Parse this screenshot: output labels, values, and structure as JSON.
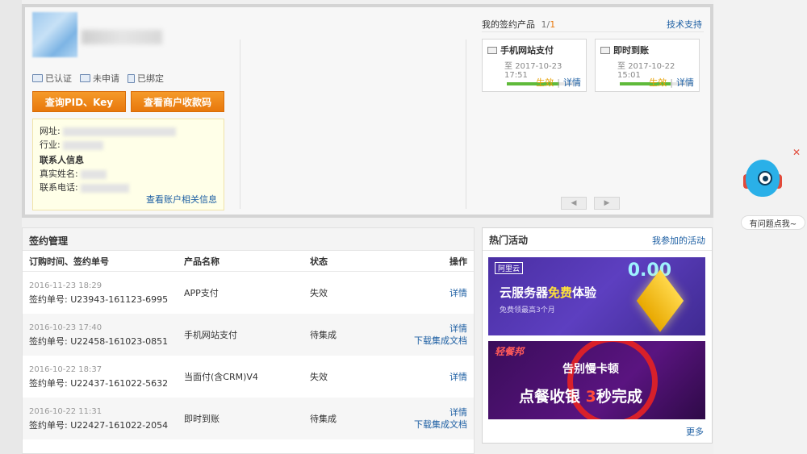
{
  "account": {
    "statuses": [
      {
        "icon": "id-card-icon",
        "label": "已认证"
      },
      {
        "icon": "form-icon",
        "label": "未申请"
      },
      {
        "icon": "lock-icon",
        "label": "已绑定"
      }
    ],
    "buttons": {
      "query_pid": "查询PID、Key",
      "view_qrcode": "查看商户收款码"
    },
    "info": {
      "website_label": "网址:",
      "industry_label": "行业:",
      "contact_title": "联系人信息",
      "name_label": "真实姓名:",
      "phone_label": "联系电话:",
      "more_link": "查看账户相关信息"
    }
  },
  "products": {
    "title": "我的签约产品",
    "count_current": "1",
    "count_sep": "/",
    "count_total": "1",
    "tech_support": "技术支持",
    "cards": [
      {
        "name": "手机网站支付",
        "prefix": "至",
        "date": "2017-10-23 17:51",
        "progress": 0.72,
        "status": "生效",
        "detail": "详情"
      },
      {
        "name": "即时到账",
        "prefix": "至",
        "date": "2017-10-22 15:01",
        "progress": 0.7,
        "status": "生效",
        "detail": "详情"
      }
    ]
  },
  "contracts": {
    "title": "签约管理",
    "headers": {
      "time": "订购时间、签约单号",
      "product": "产品名称",
      "status": "状态",
      "action": "操作"
    },
    "rows": [
      {
        "time": "2016-11-23 18:29",
        "order": "签约单号: U23943-161123-6995",
        "product": "APP支付",
        "status": "失效",
        "actions": [
          "详情"
        ]
      },
      {
        "time": "2016-10-23 17:40",
        "order": "签约单号: U22458-161023-0851",
        "product": "手机网站支付",
        "status": "待集成",
        "actions": [
          "详情",
          "下载集成文档"
        ]
      },
      {
        "time": "2016-10-22 18:37",
        "order": "签约单号: U22437-161022-5632",
        "product": "当面付(含CRM)V4",
        "status": "失效",
        "actions": [
          "详情"
        ]
      },
      {
        "time": "2016-10-22 11:31",
        "order": "签约单号: U22427-161022-2054",
        "product": "即时到账",
        "status": "待集成",
        "actions": [
          "详情",
          "下载集成文档"
        ]
      }
    ]
  },
  "activities": {
    "title": "热门活动",
    "joined_link": "我参加的活动",
    "banner1": {
      "logo": "阿里云",
      "main_a": "云服务器",
      "main_b": "免费",
      "main_c": "体验",
      "sub": "免费领最高3个月",
      "num": "0.00"
    },
    "banner2": {
      "brand": "轻餐邦",
      "line1": "告别慢卡顿",
      "line2_a": "点餐收银 ",
      "line2_b": "3",
      "line2_c": "秒完成"
    },
    "more": "更多"
  },
  "helper": {
    "bubble": "有问题点我~",
    "close": "✕"
  },
  "colors": {
    "accent": "#e8780c",
    "link": "#1d5fa3",
    "progress": "#5fba3a"
  }
}
